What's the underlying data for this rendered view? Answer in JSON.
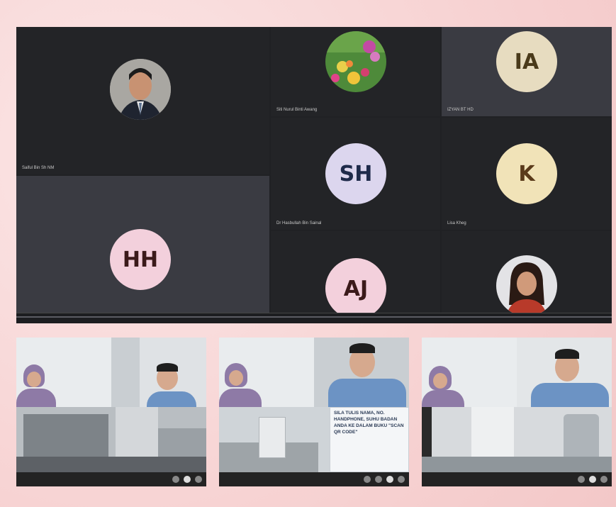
{
  "meeting": {
    "participants": [
      {
        "name": "Saiful Bin Sh NM",
        "type": "photo"
      },
      {
        "name": "Siti Nurul Binti Awang",
        "type": "photo"
      },
      {
        "name": "IZYAN BT HD",
        "initials": "IA",
        "type": "initials"
      },
      {
        "name": "Dr Hasbullah Bin Sainal",
        "initials": "SH",
        "type": "initials"
      },
      {
        "name": "Lisa Kheg",
        "initials": "K",
        "type": "initials"
      },
      {
        "name": "",
        "initials": "HH",
        "type": "initials"
      },
      {
        "name": "",
        "initials": "AJ",
        "type": "initials"
      },
      {
        "name": "",
        "type": "photo"
      }
    ]
  },
  "thumbnails": [
    {
      "id": "lab-1",
      "sign_text": ""
    },
    {
      "id": "lab-2",
      "sign_text": "SILA TULIS NAMA, NO. HANDPHONE, SUHU BADAN ANDA KE DALAM BUKU \"SCAN QR CODE\""
    },
    {
      "id": "lab-3",
      "sign_text": ""
    }
  ],
  "colors": {
    "frame": "#f9dcdc",
    "meeting_bg": "#202124",
    "avatar_ia": "#e7dcc0",
    "avatar_sh": "#dcd6ee",
    "avatar_k": "#f1e3b8",
    "avatar_hh": "#f3d0dc",
    "avatar_aj": "#f3d0dc"
  }
}
